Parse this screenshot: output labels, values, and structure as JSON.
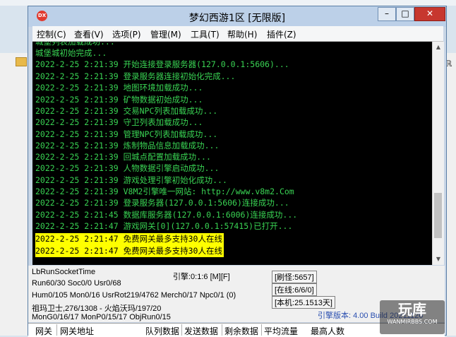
{
  "window": {
    "title": "梦幻西游1区 [无限版]",
    "app_icon_text": "DX"
  },
  "title_buttons": {
    "minimize": "–",
    "maximize": "□",
    "close": "✕"
  },
  "menu": [
    {
      "label": "控制(C)"
    },
    {
      "label": "查看(V)"
    },
    {
      "label": "选项(P)"
    },
    {
      "label": "管理(M)"
    },
    {
      "label": "工具(T)"
    },
    {
      "label": "帮助(H)"
    },
    {
      "label": "插件(Z)"
    }
  ],
  "console": {
    "lines": [
      {
        "text": "城堡列表加载成功...",
        "highlight": false
      },
      {
        "text": "城堡城初始完成...",
        "highlight": false
      },
      {
        "text": "2022-2-25 2:21:39 开始连接登录服务器(127.0.0.1:5606)...",
        "highlight": false
      },
      {
        "text": "2022-2-25 2:21:39 登录服务器连接初始化完成...",
        "highlight": false
      },
      {
        "text": "2022-2-25 2:21:39 地图环境加载成功...",
        "highlight": false
      },
      {
        "text": "2022-2-25 2:21:39 矿物数据初始成功...",
        "highlight": false
      },
      {
        "text": "2022-2-25 2:21:39 交易NPC列表加载成功...",
        "highlight": false
      },
      {
        "text": "2022-2-25 2:21:39 守卫列表加载成功...",
        "highlight": false
      },
      {
        "text": "2022-2-25 2:21:39 管理NPC列表加载成功...",
        "highlight": false
      },
      {
        "text": "2022-2-25 2:21:39 炼制物品信息加载成功...",
        "highlight": false
      },
      {
        "text": "2022-2-25 2:21:39 回城点配置加载成功...",
        "highlight": false
      },
      {
        "text": "2022-2-25 2:21:39 人物数据引擎启动成功...",
        "highlight": false
      },
      {
        "text": "2022-2-25 2:21:39 游戏处理引擎初始化成功...",
        "highlight": false
      },
      {
        "text": "2022-2-25 2:21:39 V8M2引擎唯一网站: http://www.v8m2.Com",
        "highlight": false
      },
      {
        "text": "2022-2-25 2:21:39 登录服务器(127.0.0.1:5606)连接成功...",
        "highlight": false
      },
      {
        "text": "2022-2-25 2:21:45 数据库服务器(127.0.0.1:6006)连接成功...",
        "highlight": false
      },
      {
        "text": "2022-2-25 2:21:47 游戏网关[0](127.0.0.1:57415)已打开...",
        "highlight": false
      },
      {
        "text": "2022-2-25 2:21:47 免费网关最多支持30人在线",
        "highlight": true
      },
      {
        "text": "2022-2-25 2:21:47 免费网关最多支持30人在线",
        "highlight": true
      }
    ]
  },
  "status": {
    "socket_time": "LbRunSocketTime",
    "engine": "引擎:0:1:6 [M][F]",
    "refresh": "[刷怪:5657]",
    "run_line": "Run60/30 Soc0/0 Usr0/68",
    "online": "[在线:6/6/0]",
    "hum_line": "Hum0/105 Mon0/16 UsrRot219/4762 Merch0/17 Npc0/1 (0)",
    "local": "[本机:25.1513天]",
    "boss_line": "祖玛卫士,276/1308 - 火焰沃玛/197/20",
    "engine_version": "引擎版本: 4.00 Build 20211126",
    "mon_line": "MonG0/16/17 MonP0/15/17 ObjRun0/15"
  },
  "grid_headers": [
    "网关",
    "网关地址",
    "队列数据",
    "发送数据",
    "剩余数据",
    "平均流量",
    "最高人数"
  ],
  "watermark": {
    "big": "玩库",
    "small": "WANMIRBBS.COM"
  },
  "colors": {
    "console_text": "#39d353",
    "highlight_bg": "#ffff00",
    "console_bg": "#000000",
    "close_button": "#c7372f"
  }
}
